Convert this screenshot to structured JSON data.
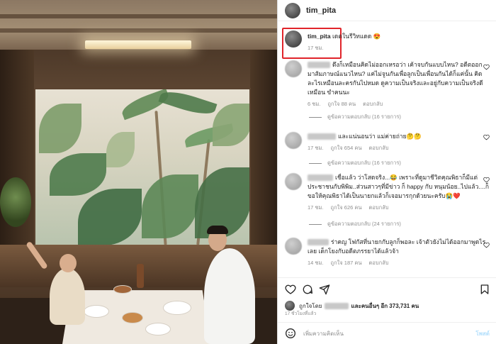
{
  "post": {
    "username": "tim_pita",
    "caption_user": "tim_pita",
    "caption_text": "เดตในรีวิทแดด",
    "caption_emoji": "😍",
    "caption_time": "17 ชม."
  },
  "comments": [
    {
      "text": "ดึงก็เหมือนคิดไม่ออกเหรอว่า เค้าจบกันแบบไหน? อดีตออกมาส้มภาษณ์แนวไหน? แค่ไม่จูนกันเพื่อลูกเป็นเพื่อนกันได้ก็แค่นั้น คิดละไรเหมือนละครกันไปหมด ดูความเป็นจริงและอยู่กับความเป็นจริงดีเหมือน ขำคนนะ",
      "time": "6 ชม.",
      "likes": "ถูกใจ 88 คน",
      "reply": "ตอบกลับ",
      "replies": "ดูข้อความตอบกลับ (16 รายการ)"
    },
    {
      "text": "และแน่นอนว่า แม่ค่ายถ่าย🤔🤔",
      "time": "17 ชม.",
      "likes": "ถูกใจ 654 คน",
      "reply": "ตอบกลับ",
      "replies": "ดูข้อความตอบกลับ (16 รายการ)"
    },
    {
      "text": "เชื่อแล้ว ว่าโสดจริง...😂 เพราะที่ดูมาชีวิตคุณพิธาก็มีแต่ประชาชนกับพิพิม..ส่วนสาวๆที่มีข่าว ก็ happy กับ หนุมน้อย..ไปแล้ว....ก็ขอให้คุณพิธาได้เป็นนายกแล้วก็เจอมารกุกด้วยนะครับ😭❤️",
      "time": "17 ชม.",
      "likes": "ถูกใจ 626 คน",
      "reply": "ตอบกลับ",
      "replies": "ดูข้อความตอบกลับ (24 รายการ)"
    },
    {
      "text": "ร่าคญ โฟกัสที่นายกกับลูกก็พอละ เจ้าตัวยังไม่ได้ออกมาพูดไรเลย เด็กโยงกับอดีตภรรยาได้แล้วจ้า",
      "time": "14 ชม.",
      "likes": "ถูกใจ 187 คน",
      "reply": "ตอบกลับ",
      "replies": ""
    }
  ],
  "likes_prefix": "ถูกใจโดย",
  "likes_suffix": "และคนอื่นๆ อีก 373,731 คน",
  "post_time": "17 ชั่วโมงที่แล้ว",
  "add_comment_placeholder": "เพิ่มความคิดเห็น",
  "post_button": "โพสต์",
  "colors": {
    "highlight": "#e0242a",
    "muted": "#8e8e8e",
    "post_disabled": "#b2dffc"
  }
}
